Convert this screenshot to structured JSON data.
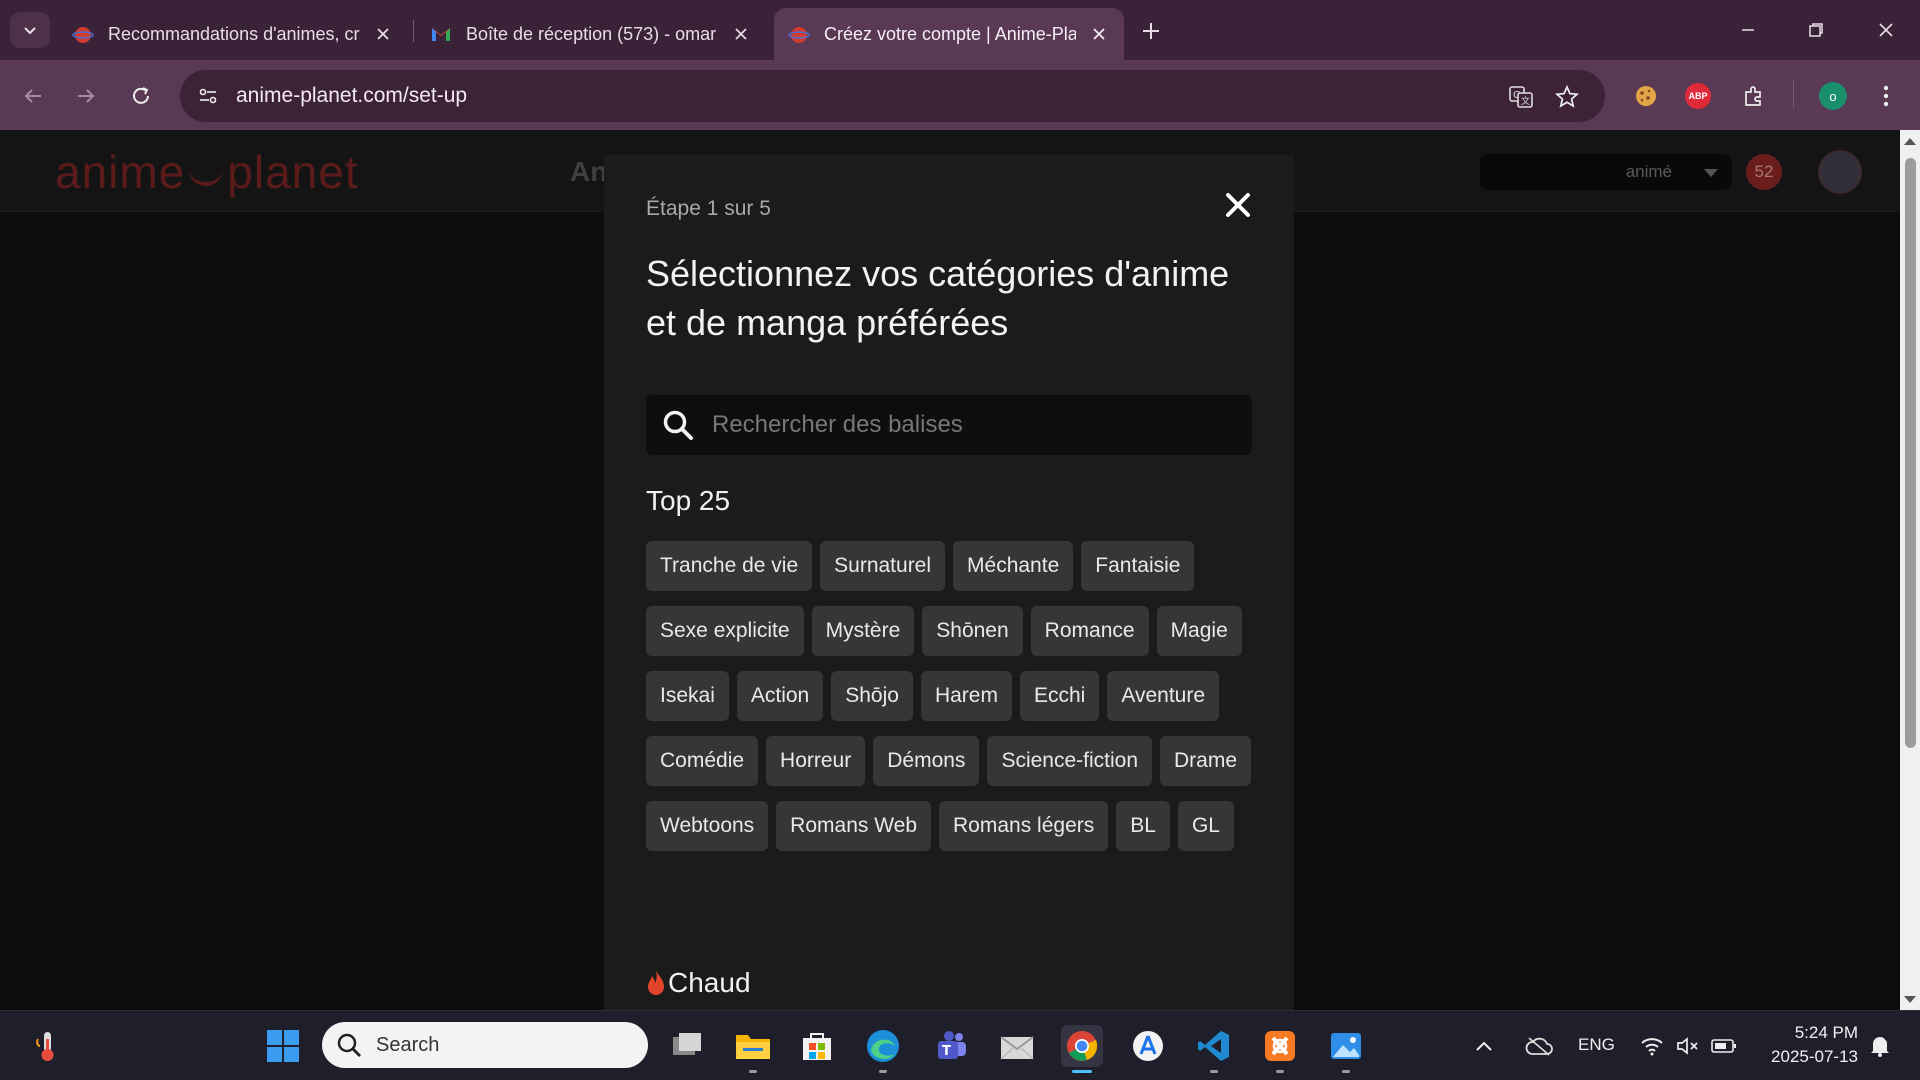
{
  "browser": {
    "tabs": [
      {
        "title": "Recommandations d'animes, cr",
        "favicon": "anime-planet-favicon",
        "active": false
      },
      {
        "title": "Boîte de réception (573) - omar",
        "favicon": "gmail-favicon",
        "active": false
      },
      {
        "title": "Créez votre compte | Anime-Pla",
        "favicon": "anime-planet-favicon",
        "active": true
      }
    ],
    "url": "anime-planet.com/set-up",
    "accent_color": "#5a3955"
  },
  "site": {
    "logo": {
      "left": "anime",
      "right": "planet"
    },
    "nav_peek": "An",
    "search_type": "animé",
    "notification_count": "52"
  },
  "modal": {
    "step": "Étape 1 sur 5",
    "title": "Sélectionnez vos catégories d'anime et de manga préférées",
    "search_placeholder": "Rechercher des balises",
    "top_section": "Top 25",
    "tags": [
      "Tranche de vie",
      "Surnaturel",
      "Méchante",
      "Fantaisie",
      "Sexe explicite",
      "Mystère",
      "Shōnen",
      "Romance",
      "Magie",
      "Isekai",
      "Action",
      "Shōjo",
      "Harem",
      "Ecchi",
      "Aventure",
      "Comédie",
      "Horreur",
      "Démons",
      "Science-fiction",
      "Drame",
      "Webtoons",
      "Romans Web",
      "Romans légers",
      "BL",
      "GL"
    ],
    "hot_section": "Chaud"
  },
  "taskbar": {
    "search_label": "Search",
    "language": "ENG",
    "time": "5:24 PM",
    "date": "2025-07-13"
  }
}
